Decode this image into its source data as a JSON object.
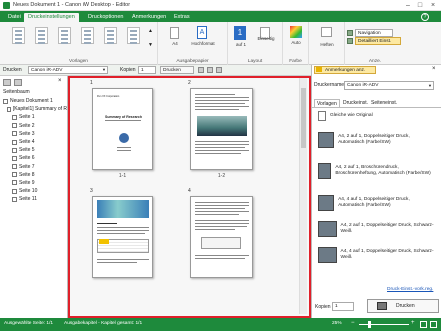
{
  "window": {
    "title": "Neues Dokument 1 - Canon iW Desktop - Editor"
  },
  "tabs": [
    "Datei",
    "Druckeinstellungen",
    "Druckoptionen",
    "Anmerkungen",
    "Extras"
  ],
  "ribbon": {
    "vorlagen_label": "Vorlagen",
    "ausgabepapier": {
      "size": "A4",
      "orientation": "Hochformat",
      "label": "Ausgabepapier"
    },
    "layout": {
      "pages": "1",
      "pages_sub": "auf 1",
      "duplex": "Einseitig",
      "label": "Layout"
    },
    "farbe": {
      "value": "Auto",
      "label": "Farbe"
    },
    "heften": {
      "value": "Heften",
      "label": ""
    },
    "anze": {
      "nav": "Navigation",
      "detail": "Detailliert Einst.",
      "label": "Anze."
    }
  },
  "printbar": {
    "drucken_label": "Drucken",
    "printer": "Canon iR-ADV",
    "kopien_label": "Kopien",
    "kopien_value": "1",
    "drucken_button": "Drucken"
  },
  "sidebar": {
    "title": "Seitenbaum",
    "root": "Neues Dokument 1",
    "chapter": "[Kapitel1] Summary of R",
    "pages": [
      "Seite 1",
      "Seite 2",
      "Seite 3",
      "Seite 4",
      "Seite 5",
      "Seite 6",
      "Seite 7",
      "Seite 8",
      "Seite 9",
      "Seite 10",
      "Seite 11"
    ]
  },
  "preview": {
    "pages": [
      {
        "num": "1",
        "label": "1-1"
      },
      {
        "num": "2",
        "label": "1-2"
      },
      {
        "num": "3",
        "label": ""
      },
      {
        "num": "4",
        "label": ""
      }
    ],
    "page1_title": "Summary of Research",
    "page1_company": "Pen XX Corporation"
  },
  "rightpanel": {
    "annotations_button": "Anmerkungen anz.",
    "druckername_label": "Druckername:",
    "druckername_value": "Canon iR-ADV",
    "subtabs": [
      "Vorlagen",
      "Druckeinst.",
      "Seiteneinst."
    ],
    "options": [
      "Gleiche wie Original",
      "A4, 2 auf 1, Doppelseitiger Druck, Automatisch (Farbe/SW)",
      "A4, 2 auf 1, Broschürendruck, Broschürenheftung, Automatisch (Farbe/SW)",
      "A4, 4 auf 1, Doppelseitiger Druck, Automatisch (Farbe/SW)",
      "A4, 2 auf 1, Doppelseitiger Druck, Schwarz-Weiß",
      "A4, 4 auf 1, Doppelseitiger Druck, Schwarz-Weiß"
    ],
    "link": "Druck-Einst.-vork.reg.",
    "kopien_label": "Kopien",
    "kopien_value": "1",
    "drucken_button": "Drucken"
  },
  "status": {
    "left": "Ausgewählte Seite: 1/1",
    "middle": "Ausgabekapitel - Kapitel gesamt: 1/1",
    "zoom": "25%"
  },
  "colors": {
    "accent": "#1e8a3c",
    "highlight": "#e0202a"
  }
}
